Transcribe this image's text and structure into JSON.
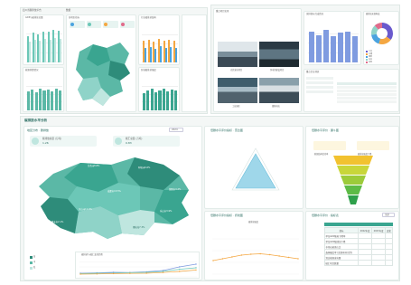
{
  "page": {
    "title": "四川省碳排放平台",
    "tab": "数据"
  },
  "top_left": {
    "p1": {
      "title": "GDP与碳排放总量",
      "legend": [
        "GDP",
        "碳排放"
      ]
    },
    "p2": {
      "title": "各地区指标",
      "kpis": [
        "年度",
        "区县",
        "碳强度",
        "能源"
      ]
    },
    "p3": {
      "title": "行业碳排放结构"
    },
    "p4": {
      "title": "能源消费情况"
    },
    "p5": {
      "title": "区域碳排放强度"
    }
  },
  "top_right": {
    "gallery": {
      "title": "重点项目实景",
      "captions": [
        "光伏发电项目",
        "风电场建设项目",
        "工业园区",
        "储能电站"
      ]
    },
    "barchart": {
      "title": "减排指标完成情况"
    },
    "donut": {
      "title": "碳排放来源构成",
      "slices": [
        {
          "label": "工业",
          "value": 35,
          "color": "#6a5acd"
        },
        {
          "label": "交通",
          "value": 20,
          "color": "#f4a742"
        },
        {
          "label": "建筑",
          "value": 18,
          "color": "#4aa3df"
        },
        {
          "label": "农业",
          "value": 15,
          "color": "#8fd3c8"
        },
        {
          "label": "其他",
          "value": 12,
          "color": "#e06b8b"
        }
      ]
    },
    "table": {
      "title": "重点企业排放"
    }
  },
  "bottom": {
    "header": {
      "title": "碳排放水平分析",
      "select": "2024"
    },
    "map": {
      "title": "地区分布 · 碳排放",
      "stats": [
        {
          "label": "碳排放总量 (万吨)",
          "value": "1.26"
        },
        {
          "label": "碳汇总量 (万吨)",
          "value": "0.83"
        }
      ],
      "regions": [
        "甘孜州8.8%",
        "阿坝州6.6%",
        "成都市15.5%",
        "凉山州11.4%",
        "绵阳市4.2%",
        "乐山市3.9%",
        "雅安市2.1%",
        "攀枝花7.3%"
      ],
      "legend": [
        "高",
        "中",
        "低"
      ],
      "linechart_title": "碳排放与碳汇变化趋势"
    },
    "radar": {
      "title": "低碳水平评价指标 · 雷达图"
    },
    "funnel": {
      "title": "低碳水平评价 · 漏斗图",
      "notes": [
        "能源结构优化率",
        "碳排放强度下降"
      ]
    },
    "line": {
      "title": "低碳水平评价指标 · 折线图",
      "series": "碳排放强度"
    },
    "table": {
      "title": "低碳水平评价 · 指标表",
      "select": "全部",
      "headers": [
        "指标",
        "2022年度",
        "2023年度",
        "变化"
      ],
      "rows": [
        [
          "单位GDP能耗下降率",
          "",
          "",
          ""
        ],
        [
          "单位GDP碳排放下降",
          "",
          "",
          ""
        ],
        [
          "非化石能源占比",
          "",
          "",
          ""
        ],
        [
          "森林覆盖率 (含灌木林) 提升",
          "",
          "",
          ""
        ],
        [
          "清洁能源发电量",
          "",
          "",
          ""
        ],
        [
          "碳汇项目数量",
          "",
          "",
          ""
        ]
      ]
    }
  },
  "chart_data": [
    {
      "type": "bar",
      "title": "GDP与碳排放总量",
      "categories": [
        "1",
        "2",
        "3",
        "4",
        "5",
        "6",
        "7"
      ],
      "series": [
        {
          "values": [
            70,
            78,
            75,
            82,
            80,
            85,
            83
          ]
        },
        {
          "values": [
            55,
            60,
            58,
            62,
            60,
            65,
            63
          ]
        }
      ],
      "ylim": [
        0,
        100
      ]
    },
    {
      "type": "bar",
      "title": "行业碳排放结构",
      "categories": [
        "1",
        "2",
        "3",
        "4",
        "5",
        "6",
        "7"
      ],
      "series": [
        {
          "values": [
            60,
            62,
            58,
            64,
            61,
            63,
            59
          ]
        },
        {
          "values": [
            40,
            42,
            38,
            44,
            41,
            43,
            39
          ]
        }
      ],
      "ylim": [
        0,
        100
      ]
    },
    {
      "type": "bar",
      "title": "减排指标完成情况",
      "categories": [
        "1",
        "2",
        "3",
        "4",
        "5",
        "6",
        "7"
      ],
      "values": [
        80,
        72,
        85,
        68,
        78,
        82,
        70
      ],
      "ylim": [
        0,
        100
      ]
    },
    {
      "type": "bar",
      "title": "能源消费情况",
      "categories": [
        "1",
        "2",
        "3",
        "4",
        "5",
        "6",
        "7",
        "8",
        "9"
      ],
      "values": [
        60,
        65,
        58,
        70,
        62,
        66,
        61,
        68,
        64
      ],
      "ylim": [
        0,
        100
      ]
    },
    {
      "type": "bar",
      "title": "区域碳排放强度",
      "categories": [
        "1",
        "2",
        "3",
        "4",
        "5",
        "6",
        "7",
        "8",
        "9"
      ],
      "values": [
        55,
        62,
        68,
        58,
        64,
        70,
        60,
        66,
        63
      ],
      "ylim": [
        0,
        100
      ]
    },
    {
      "type": "line",
      "title": "碳排放与碳汇变化趋势",
      "x": [
        2016,
        2017,
        2018,
        2019,
        2020,
        2021,
        2022,
        2023
      ],
      "series": [
        {
          "values": [
            20,
            22,
            25,
            24,
            28,
            35,
            55,
            70
          ]
        },
        {
          "values": [
            18,
            20,
            21,
            23,
            25,
            30,
            42,
            50
          ]
        },
        {
          "values": [
            15,
            16,
            18,
            19,
            20,
            24,
            30,
            38
          ]
        }
      ],
      "ylim": [
        0,
        100
      ]
    },
    {
      "type": "line",
      "title": "低碳水平评价指标 · 折线图",
      "x": [
        "1",
        "2",
        "3",
        "4",
        "5",
        "6",
        "7",
        "8",
        "9",
        "10"
      ],
      "series": [
        {
          "values": [
            30,
            34,
            38,
            42,
            44,
            45,
            43,
            40,
            37,
            34
          ]
        }
      ],
      "ylim": [
        0,
        100
      ]
    }
  ]
}
